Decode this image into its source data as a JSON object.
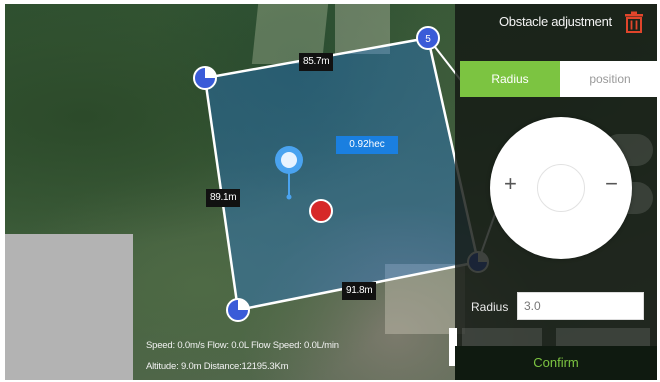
{
  "map": {
    "edge_labels": {
      "top": "85.7m",
      "left": "89.1m",
      "bottom": "91.8m"
    },
    "vertex_label": "5",
    "area_label": "0.92hec"
  },
  "status": {
    "line1": "Speed: 0.0m/s   Flow: 0.0L   Flow Speed: 0.0L/min",
    "line2": "Altitude: 9.0m   Distance:12195.3Km"
  },
  "panel": {
    "title": "Obstacle adjustment",
    "tabs": {
      "radius": "Radius",
      "position": "position"
    },
    "joystick": {
      "plus": "+",
      "minus": "−"
    },
    "radius_label": "Radius",
    "radius_value": "3.0",
    "confirm": "Confirm"
  },
  "colors": {
    "accent_green": "#7cc441",
    "polygon_fill": "rgba(40,120,220,0.35)",
    "vertex_blue": "#3a5bd8",
    "obstacle_red": "#d62828",
    "area_label_bg": "#1a7fe0",
    "trash_red": "#e0452b"
  }
}
